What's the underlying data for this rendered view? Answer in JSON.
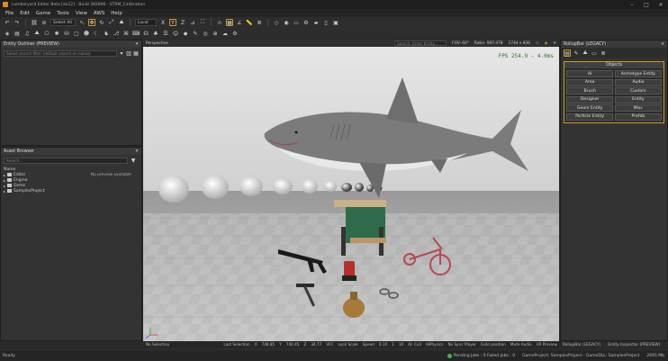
{
  "window": {
    "title": "Lumberyard Editor Beta [dx12] - Build 392896 - STRM_Calibration"
  },
  "menu": [
    "File",
    "Edit",
    "Game",
    "Tools",
    "View",
    "AWS",
    "Help"
  ],
  "toolbar1": {
    "select_label": "Select All",
    "space_label": "Local"
  },
  "entity_outliner": {
    "title": "Entity Outliner (PREVIEW)",
    "search_placeholder": "Select search filter (default search on name)"
  },
  "asset_browser": {
    "title": "Asset Browser",
    "search_placeholder": "Search...",
    "name_header": "Name",
    "preview_text": "No preview available",
    "items": [
      "Editor",
      "Engine",
      "Gems",
      "SamplesProject"
    ]
  },
  "viewport": {
    "tab_label": "Perspective",
    "search_placeholder": "Search, Enter Entity...",
    "fov": "FOV: 60°",
    "ratio": "Ratio: 997:478",
    "resolution": "1744 x 836",
    "fps": "FPS 254.9 - 4.0ms"
  },
  "status_bar": {
    "selection": "No Selection",
    "last_selection": "Last Selection",
    "x_label": "X",
    "x_val": "748.85",
    "y_label": "Y",
    "y_val": "740.45",
    "z_label": "Z",
    "z_val": "34.77",
    "vfc": "VFC",
    "lock_scale": "Lock Scale",
    "speed_label": "Speed",
    "speed_val": "0.10",
    "speed_a": "1",
    "speed_b": "10",
    "ai_cull": "AI: Cull",
    "ai_physics": "AIPhysics",
    "no_sync": "No Sync Player",
    "goto_pos": "Goto position",
    "mute_audio": "Mute Audio",
    "vr_preview": "VR Preview"
  },
  "rollup": {
    "title": "RollupBar (LEGACY)",
    "objects_header": "Objects",
    "buttons": [
      "AI",
      "Archetype Entity",
      "Area",
      "Audio",
      "Brush",
      "Custom",
      "Designer",
      "Entity",
      "Geom Entity",
      "Misc",
      "Particle Entity",
      "Prefab"
    ]
  },
  "bottom_tabs": [
    "RollupBar (LEGACY)",
    "Entity Inspector (PREVIEW)"
  ],
  "footer": {
    "left": "Ready",
    "pending": "Pending Jobs : 0  Failed Jobs : 0",
    "gameproject": "GameProject: SamplesProject - GameDLL: SamplesProject",
    "mem": "2695 Mb"
  }
}
